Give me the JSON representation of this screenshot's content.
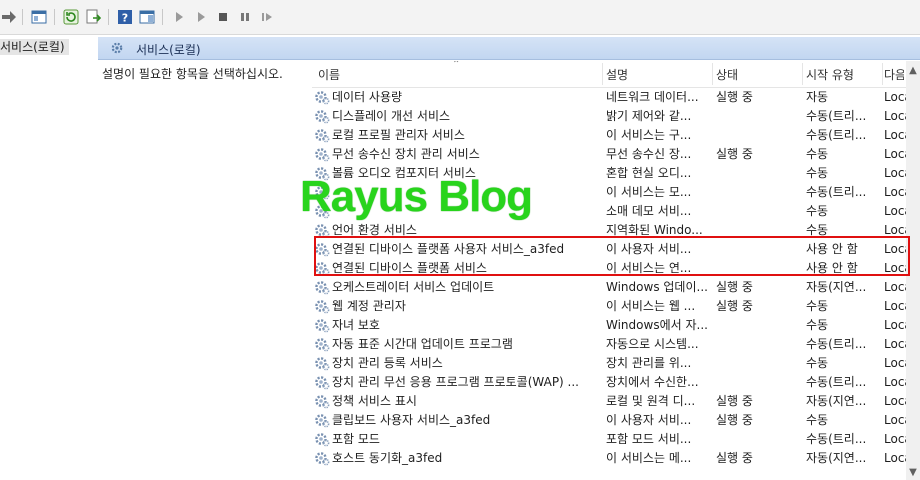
{
  "tree": {
    "root_label": "서비스(로컬)"
  },
  "pane": {
    "title": "서비스(로컬)",
    "description": "설명이 필요한 항목을 선택하십시오."
  },
  "columns": {
    "name": "이름",
    "description": "설명",
    "state": "상태",
    "startup": "시작 유형",
    "logon": "다음"
  },
  "services": [
    {
      "name": "데이터 사용량",
      "description": "네트워크 데이터...",
      "state": "실행 중",
      "startup": "자동",
      "logon": "Loca"
    },
    {
      "name": "디스플레이 개선 서비스",
      "description": "밝기 제어와 같...",
      "state": "",
      "startup": "수동(트리...",
      "logon": "Loca"
    },
    {
      "name": "로컬 프로필 관리자 서비스",
      "description": "이 서비스는 구...",
      "state": "",
      "startup": "수동(트리...",
      "logon": "Loca"
    },
    {
      "name": "무선 송수신 장치 관리 서비스",
      "description": "무선 송수신 장...",
      "state": "실행 중",
      "startup": "수동",
      "logon": "Loca"
    },
    {
      "name": "볼륨 오디오 컴포지터 서비스",
      "description": "혼합 현실 오디...",
      "state": "",
      "startup": "수동",
      "logon": "Loca"
    },
    {
      "name": "",
      "description": "이 서비스는 모...",
      "state": "",
      "startup": "수동(트리...",
      "logon": "Loca"
    },
    {
      "name": "",
      "description": "소매 데모 서비...",
      "state": "",
      "startup": "수동",
      "logon": "Loca"
    },
    {
      "name": "언어 환경 서비스",
      "description": "지역화된 Windo...",
      "state": "",
      "startup": "수동",
      "logon": "Loca"
    },
    {
      "name": "연결된 디바이스 플랫폼 사용자 서비스_a3fed",
      "description": "이 사용자 서비...",
      "state": "",
      "startup": "사용 안 함",
      "logon": "Loca"
    },
    {
      "name": "연결된 디바이스 플랫폼 서비스",
      "description": "이 서비스는 연...",
      "state": "",
      "startup": "사용 안 함",
      "logon": "Loca"
    },
    {
      "name": "오케스트레이터 서비스 업데이트",
      "description": "Windows 업데이...",
      "state": "실행 중",
      "startup": "자동(지연...",
      "logon": "Loca"
    },
    {
      "name": "웹 계정 관리자",
      "description": "이 서비스는 웹 ...",
      "state": "실행 중",
      "startup": "수동",
      "logon": "Loca"
    },
    {
      "name": "자녀 보호",
      "description": "Windows에서 자...",
      "state": "",
      "startup": "수동",
      "logon": "Loca"
    },
    {
      "name": "자동 표준 시간대 업데이트 프로그램",
      "description": "자동으로 시스템...",
      "state": "",
      "startup": "수동(트리...",
      "logon": "Loca"
    },
    {
      "name": "장치 관리 등록 서비스",
      "description": "장치 관리를 위...",
      "state": "",
      "startup": "수동",
      "logon": "Loca"
    },
    {
      "name": "장치 관리 무선 응용 프로그램 프로토콜(WAP) ...",
      "description": "장치에서 수신한...",
      "state": "",
      "startup": "수동(트리...",
      "logon": "Loca"
    },
    {
      "name": "정책 서비스 표시",
      "description": "로컬 및 원격 디...",
      "state": "실행 중",
      "startup": "자동(지연...",
      "logon": "Loca"
    },
    {
      "name": "클립보드 사용자 서비스_a3fed",
      "description": "이 사용자 서비...",
      "state": "실행 중",
      "startup": "수동",
      "logon": "Loca"
    },
    {
      "name": "포함 모드",
      "description": "포함 모드 서비...",
      "state": "",
      "startup": "수동(트리...",
      "logon": "Loca"
    },
    {
      "name": "호스트 동기화_a3fed",
      "description": "이 서비스는 메...",
      "state": "실행 중",
      "startup": "자동(지연...",
      "logon": "Loca"
    }
  ],
  "watermark": "Rayus Blog",
  "colors": {
    "highlight": "#e01010",
    "watermark": "#28d41c",
    "header_band": "#c8daf3"
  }
}
